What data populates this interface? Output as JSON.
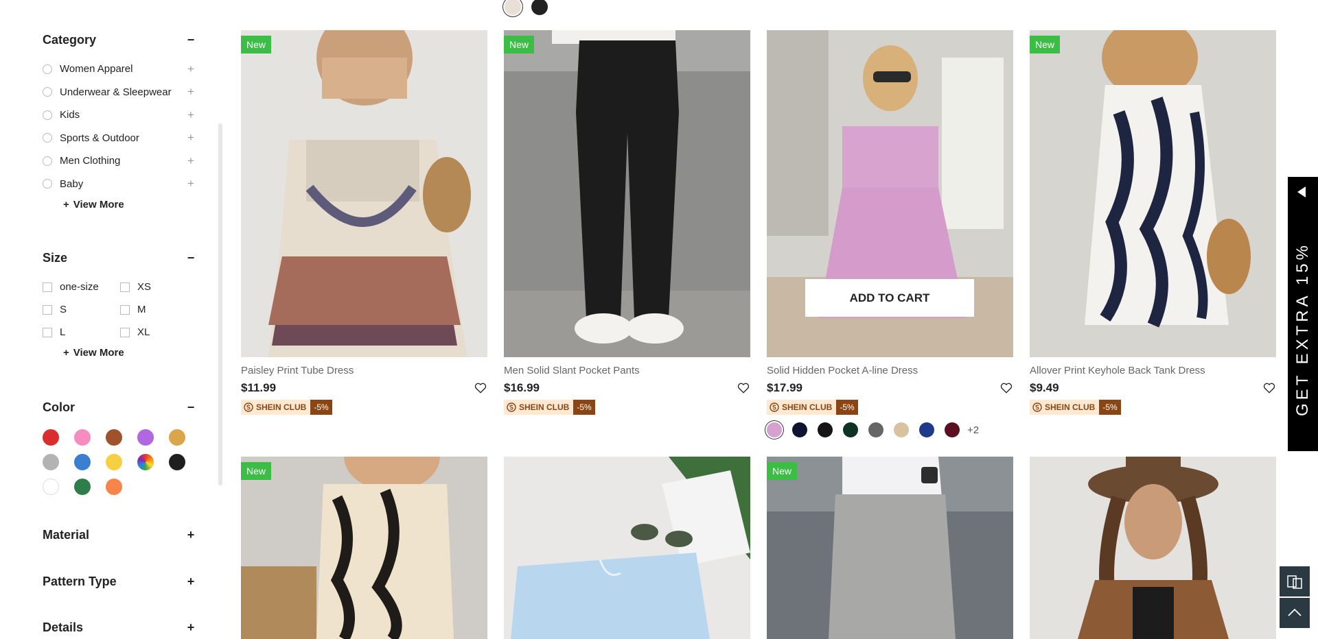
{
  "sidebar": {
    "category": {
      "title": "Category",
      "toggle": "−",
      "items": [
        {
          "label": "Women Apparel"
        },
        {
          "label": "Underwear & Sleepwear"
        },
        {
          "label": "Kids"
        },
        {
          "label": "Sports & Outdoor"
        },
        {
          "label": "Men Clothing"
        },
        {
          "label": "Baby"
        }
      ],
      "view_more": "View More"
    },
    "size": {
      "title": "Size",
      "toggle": "−",
      "items": [
        "one-size",
        "XS",
        "S",
        "M",
        "L",
        "XL"
      ],
      "view_more": "View More"
    },
    "color": {
      "title": "Color",
      "toggle": "−",
      "swatches": [
        "#d92e2e",
        "#f78cc0",
        "#a0522d",
        "#b167e0",
        "#dba54a",
        "#b3b3b3",
        "#3a7fd0",
        "#f7cf43",
        "multicolor",
        "#1f1f1f",
        "#ffffff",
        "#2e7d4a",
        "#f8844a"
      ]
    },
    "material": {
      "title": "Material",
      "toggle": "+"
    },
    "pattern_type": {
      "title": "Pattern Type",
      "toggle": "+"
    },
    "details": {
      "title": "Details",
      "toggle": "+"
    }
  },
  "top_color_dots": [
    "#e8e0d6",
    "#222222"
  ],
  "products": [
    {
      "name": "Paisley Print Tube Dress",
      "price": "$11.99",
      "badge": "New",
      "club": "SHEIN CLUB",
      "discount": "-5%"
    },
    {
      "name": "Men Solid Slant Pocket Pants",
      "price": "$16.99",
      "badge": "New",
      "club": "SHEIN CLUB",
      "discount": "-5%"
    },
    {
      "name": "Solid Hidden Pocket A-line Dress",
      "price": "$17.99",
      "badge": "",
      "club": "SHEIN CLUB",
      "discount": "-5%",
      "add_to_cart": "ADD TO CART",
      "colors": [
        "#d6a0cf",
        "#0f1433",
        "#151515",
        "#0d3324",
        "#666666",
        "#d8c2a0",
        "#1e3a8a",
        "#5a1020"
      ],
      "more_colors": "+2"
    },
    {
      "name": "Allover Print Keyhole Back Tank Dress",
      "price": "$9.49",
      "badge": "New",
      "club": "SHEIN CLUB",
      "discount": "-5%"
    },
    {
      "badge": "New"
    },
    {
      "badge": ""
    },
    {
      "badge": "New"
    },
    {
      "badge": ""
    }
  ],
  "promo": {
    "text": "GET EXTRA 15%"
  }
}
